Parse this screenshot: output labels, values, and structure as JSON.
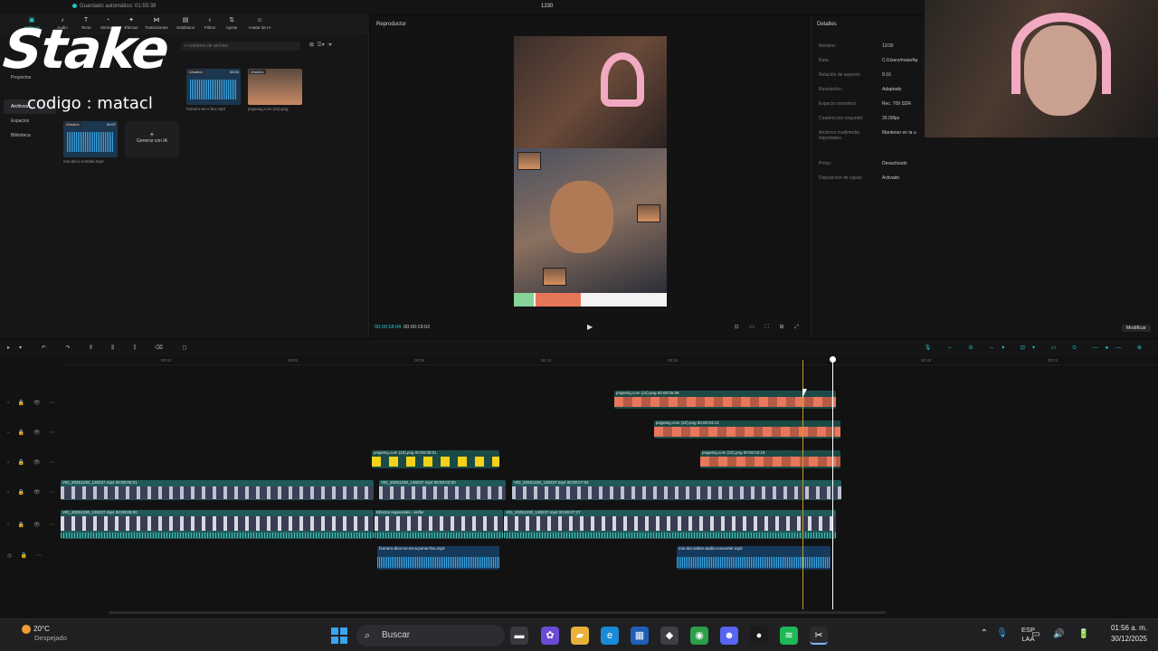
{
  "titlebar": {
    "autosave": "Guardado automático: 01:55:38",
    "project": "1230"
  },
  "toolbar": {
    "items": [
      {
        "label": "Archivos multimedia",
        "icon": "media-icon"
      },
      {
        "label": "Audio",
        "icon": "audio-icon"
      },
      {
        "label": "Texto",
        "icon": "text-icon"
      },
      {
        "label": "Stickers",
        "icon": "sticker-icon"
      },
      {
        "label": "Efectos",
        "icon": "effects-icon"
      },
      {
        "label": "Transiciones",
        "icon": "transition-icon"
      },
      {
        "label": "Subtítulos",
        "icon": "subtitle-icon"
      },
      {
        "label": "Filtros",
        "icon": "filter-icon"
      },
      {
        "label": "Ajuste",
        "icon": "adjust-icon"
      },
      {
        "label": "Avatar de IA",
        "icon": "avatar-icon"
      }
    ]
  },
  "overlay": {
    "brand": "Stake",
    "code": "codigo : matacl"
  },
  "media": {
    "nav": [
      "Proyectos",
      "Archivos",
      "Espacios",
      "Biblioteca"
    ],
    "search_placeholder": "o nombres de archivo",
    "items": [
      {
        "badge": "Añadido",
        "duration": "00:03",
        "name": "homero-se-v-feo.mp3",
        "kind": "audio"
      },
      {
        "badge": "Añadido",
        "duration": "",
        "name": "pngwing.com (22).png",
        "kind": "image"
      },
      {
        "badge": "Añadido",
        "duration": "00:07",
        "name": "mix-doi-o-zombie.mp3",
        "kind": "audio"
      },
      {
        "badge": "",
        "duration": "",
        "name": "Generar con IA",
        "kind": "generate"
      }
    ]
  },
  "player": {
    "title": "Reproductor",
    "current_time": "00:00:18:04",
    "total_time": "00:00:19:02",
    "play_icon": "▶",
    "tools": "⊡ ▭ ⛶ ⊞ ⤢"
  },
  "details": {
    "title": "Detalles",
    "rows": [
      {
        "k": "Nombre:",
        "v": "12/30"
      },
      {
        "k": "Ruta:",
        "v": "C:/Users/mata/Ap"
      },
      {
        "k": "Relación de aspecto:",
        "v": "9:16"
      },
      {
        "k": "Resolución:",
        "v": "Adaptado"
      },
      {
        "k": "Espacio cromático:",
        "v": "Rec. 709 SDR"
      },
      {
        "k": "Cuadros por segundo:",
        "v": "30.00fps"
      },
      {
        "k": "Archivos multimedia importados:",
        "v": "Mantener en la u"
      },
      {
        "k": "Proxy:",
        "v": "Desactivado"
      },
      {
        "k": "Disposición de capas:",
        "v": "Activado"
      }
    ],
    "modify": "Modificar"
  },
  "timeline": {
    "ticks": [
      "00:02",
      "00:04",
      "00:06",
      "00:12",
      "00:16",
      "00:20",
      "00:24"
    ],
    "clips": [
      {
        "type": "sticker-clip",
        "label": "pngwing.com (22).png  00:00:05:08"
      },
      {
        "type": "sticker-clip",
        "label": "pngwing.com (22).png  00:00:04:13"
      },
      {
        "type": "emoji-clip",
        "label": "pngwing.com (23).png  00:00:05:01"
      },
      {
        "type": "sticker-clip",
        "label": "pngwing.com (22).png  00:00:03:19"
      },
      {
        "type": "video-clip",
        "label": "VID_20251230_130237.mp4  00:00:08:01"
      },
      {
        "type": "video-clip",
        "label": "VID_20251230_130237.mp4  00:00:02:00"
      },
      {
        "type": "video-clip",
        "label": "VID_20251230_130237.mp4  00:00:07:04"
      },
      {
        "type": "main-clip",
        "label": "VID_20251230_130237.mp4  00:00:08:00"
      },
      {
        "type": "main-clip",
        "label": "Efectos especiales - enfler"
      },
      {
        "type": "main-clip",
        "label": "VID_20251230_130237.mp4  00:00:07:27"
      },
      {
        "type": "audio-clip",
        "label": "homero-dice-no-es-a-poner-feo.mp3"
      },
      {
        "type": "audio-clip",
        "label": "mix-doi-online-audio-converter.mp3"
      }
    ]
  },
  "taskbar": {
    "temp": "20°C",
    "condition": "Despejado",
    "search": "Buscar",
    "lang1": "ESP",
    "lang2": "LAA",
    "time": "01:56 a. m.",
    "date": "30/12/2025",
    "apps": [
      "widgets-icon",
      "files-icon",
      "copilot-icon",
      "folder-icon",
      "edge-icon",
      "store-icon",
      "app-icon",
      "chrome-icon",
      "discord-icon",
      "opera-icon",
      "spotify-icon",
      "capcut-icon"
    ]
  },
  "colors": {
    "accent": "#22d3d3",
    "playhead": "#ffffff",
    "hover": "#c79a2a"
  }
}
